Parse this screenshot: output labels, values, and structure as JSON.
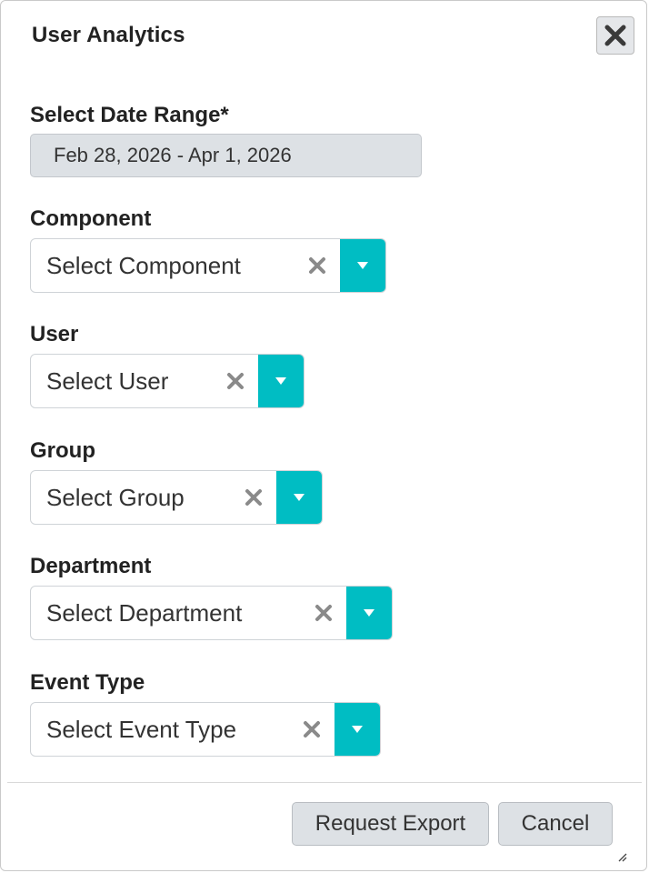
{
  "dialog": {
    "title": "User Analytics",
    "close_icon": "close-x-icon"
  },
  "date_range": {
    "label": "Select Date Range*",
    "value": "Feb 28, 2026 - Apr 1, 2026"
  },
  "fields": [
    {
      "label": "Component",
      "placeholder": "Select Component"
    },
    {
      "label": "User",
      "placeholder": "Select User"
    },
    {
      "label": "Group",
      "placeholder": "Select Group"
    },
    {
      "label": "Department",
      "placeholder": "Select Department"
    },
    {
      "label": "Event Type",
      "placeholder": "Select Event Type"
    }
  ],
  "footer": {
    "request_export_label": "Request Export",
    "cancel_label": "Cancel"
  },
  "colors": {
    "accent": "#00bdc3",
    "input_bg": "#dde1e5",
    "clear_icon": "#8a8a8a"
  }
}
